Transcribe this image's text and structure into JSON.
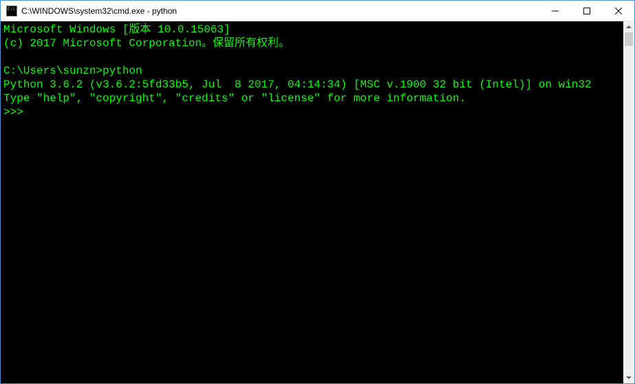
{
  "titlebar": {
    "title": "C:\\WINDOWS\\system32\\cmd.exe - python"
  },
  "console": {
    "lines": [
      "Microsoft Windows [版本 10.0.15063]",
      "(c) 2017 Microsoft Corporation。保留所有权利。",
      "",
      "C:\\Users\\sunzn>python",
      "Python 3.6.2 (v3.6.2:5fd33b5, Jul  8 2017, 04:14:34) [MSC v.1900 32 bit (Intel)] on win32",
      "Type \"help\", \"copyright\", \"credits\" or \"license\" for more information.",
      ">>> "
    ]
  }
}
